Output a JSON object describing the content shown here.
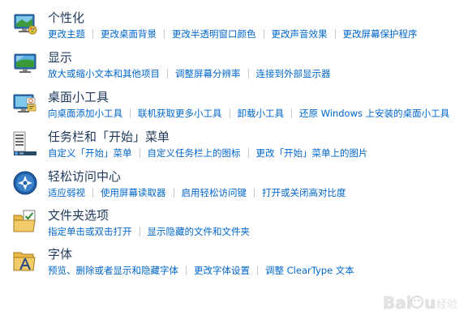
{
  "categories": [
    {
      "icon": "personalization-icon",
      "title": "个性化",
      "links": [
        "更改主题",
        "更改桌面背景",
        "更改半透明窗口颜色",
        "更改声音效果",
        "更改屏幕保护程序"
      ]
    },
    {
      "icon": "display-icon",
      "title": "显示",
      "links": [
        "放大或缩小文本和其他项目",
        "调整屏幕分辨率",
        "连接到外部显示器"
      ]
    },
    {
      "icon": "desktop-gadgets-icon",
      "title": "桌面小工具",
      "links": [
        "向桌面添加小工具",
        "联机获取更多小工具",
        "卸载小工具",
        "还原 Windows 上安装的桌面小工具"
      ]
    },
    {
      "icon": "taskbar-start-menu-icon",
      "title": "任务栏和「开始」菜单",
      "links": [
        "自定义「开始」菜单",
        "自定义任务栏上的图标",
        "更改「开始」菜单上的图片"
      ]
    },
    {
      "icon": "ease-of-access-icon",
      "title": "轻松访问中心",
      "links": [
        "适应弱视",
        "使用屏幕读取器",
        "启用轻松访问键",
        "打开或关闭高对比度"
      ]
    },
    {
      "icon": "folder-options-icon",
      "title": "文件夹选项",
      "links": [
        "指定单击或双击打开",
        "显示隐藏的文件和文件夹"
      ]
    },
    {
      "icon": "fonts-icon",
      "title": "字体",
      "links": [
        "预览、删除或者显示和隐藏字体",
        "更改字体设置",
        "调整 ClearType 文本"
      ]
    }
  ],
  "colors": {
    "title": "#1e395b",
    "link": "#0066cc",
    "separator": "#c8c8c8"
  },
  "watermark": {
    "icon": "baidu-jingyan-watermark-icon",
    "text": "Baidu 经验"
  }
}
